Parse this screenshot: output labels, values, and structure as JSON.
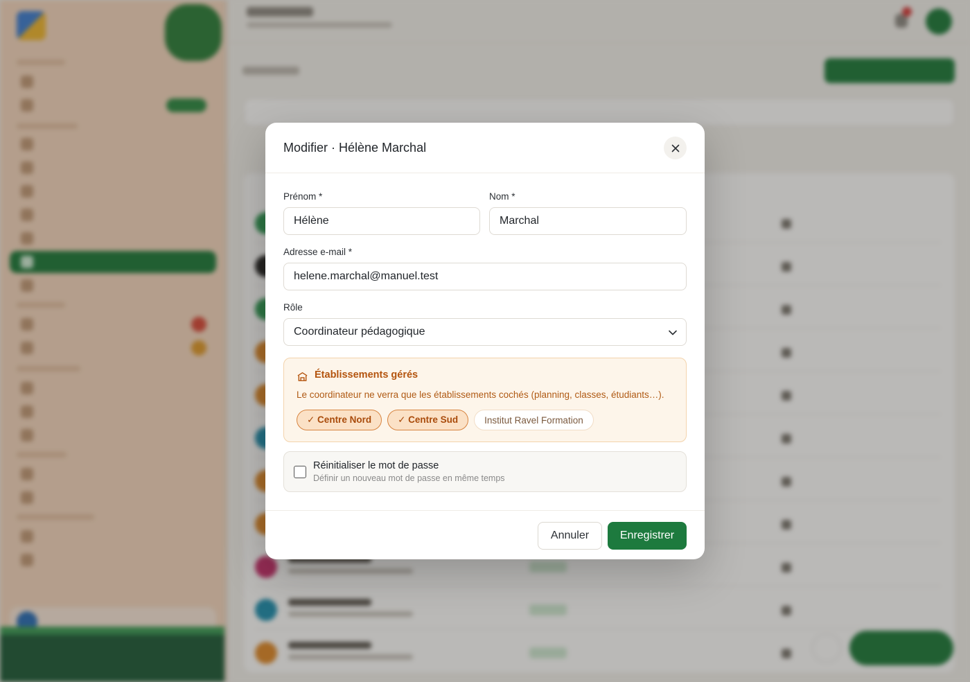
{
  "modal": {
    "title": "Modifier · Hélène Marchal",
    "fields": {
      "firstname": {
        "label": "Prénom *",
        "value": "Hélène"
      },
      "lastname": {
        "label": "Nom *",
        "value": "Marchal"
      },
      "email": {
        "label": "Adresse e-mail *",
        "value": "helene.marchal@manuel.test"
      },
      "role": {
        "label": "Rôle",
        "value": "Coordinateur pédagogique"
      }
    },
    "establishments": {
      "title": "Établissements gérés",
      "description": "Le coordinateur ne verra que les établissements cochés (planning, classes, étudiants…).",
      "chips": [
        {
          "label": "✓ Centre Nord",
          "selected": true
        },
        {
          "label": "✓ Centre Sud",
          "selected": true
        },
        {
          "label": "Institut Ravel Formation",
          "selected": false
        }
      ]
    },
    "reset_password": {
      "title": "Réinitialiser le mot de passe",
      "subtitle": "Définir un nouveau mot de passe en même temps",
      "checked": false
    },
    "buttons": {
      "cancel": "Annuler",
      "save": "Enregistrer"
    }
  },
  "colors": {
    "primary": "#1d7a3e",
    "accent_orange": "#b4540e",
    "chip_selected_bg": "#fbe1c6",
    "panel_bg": "#fdf5ea"
  }
}
